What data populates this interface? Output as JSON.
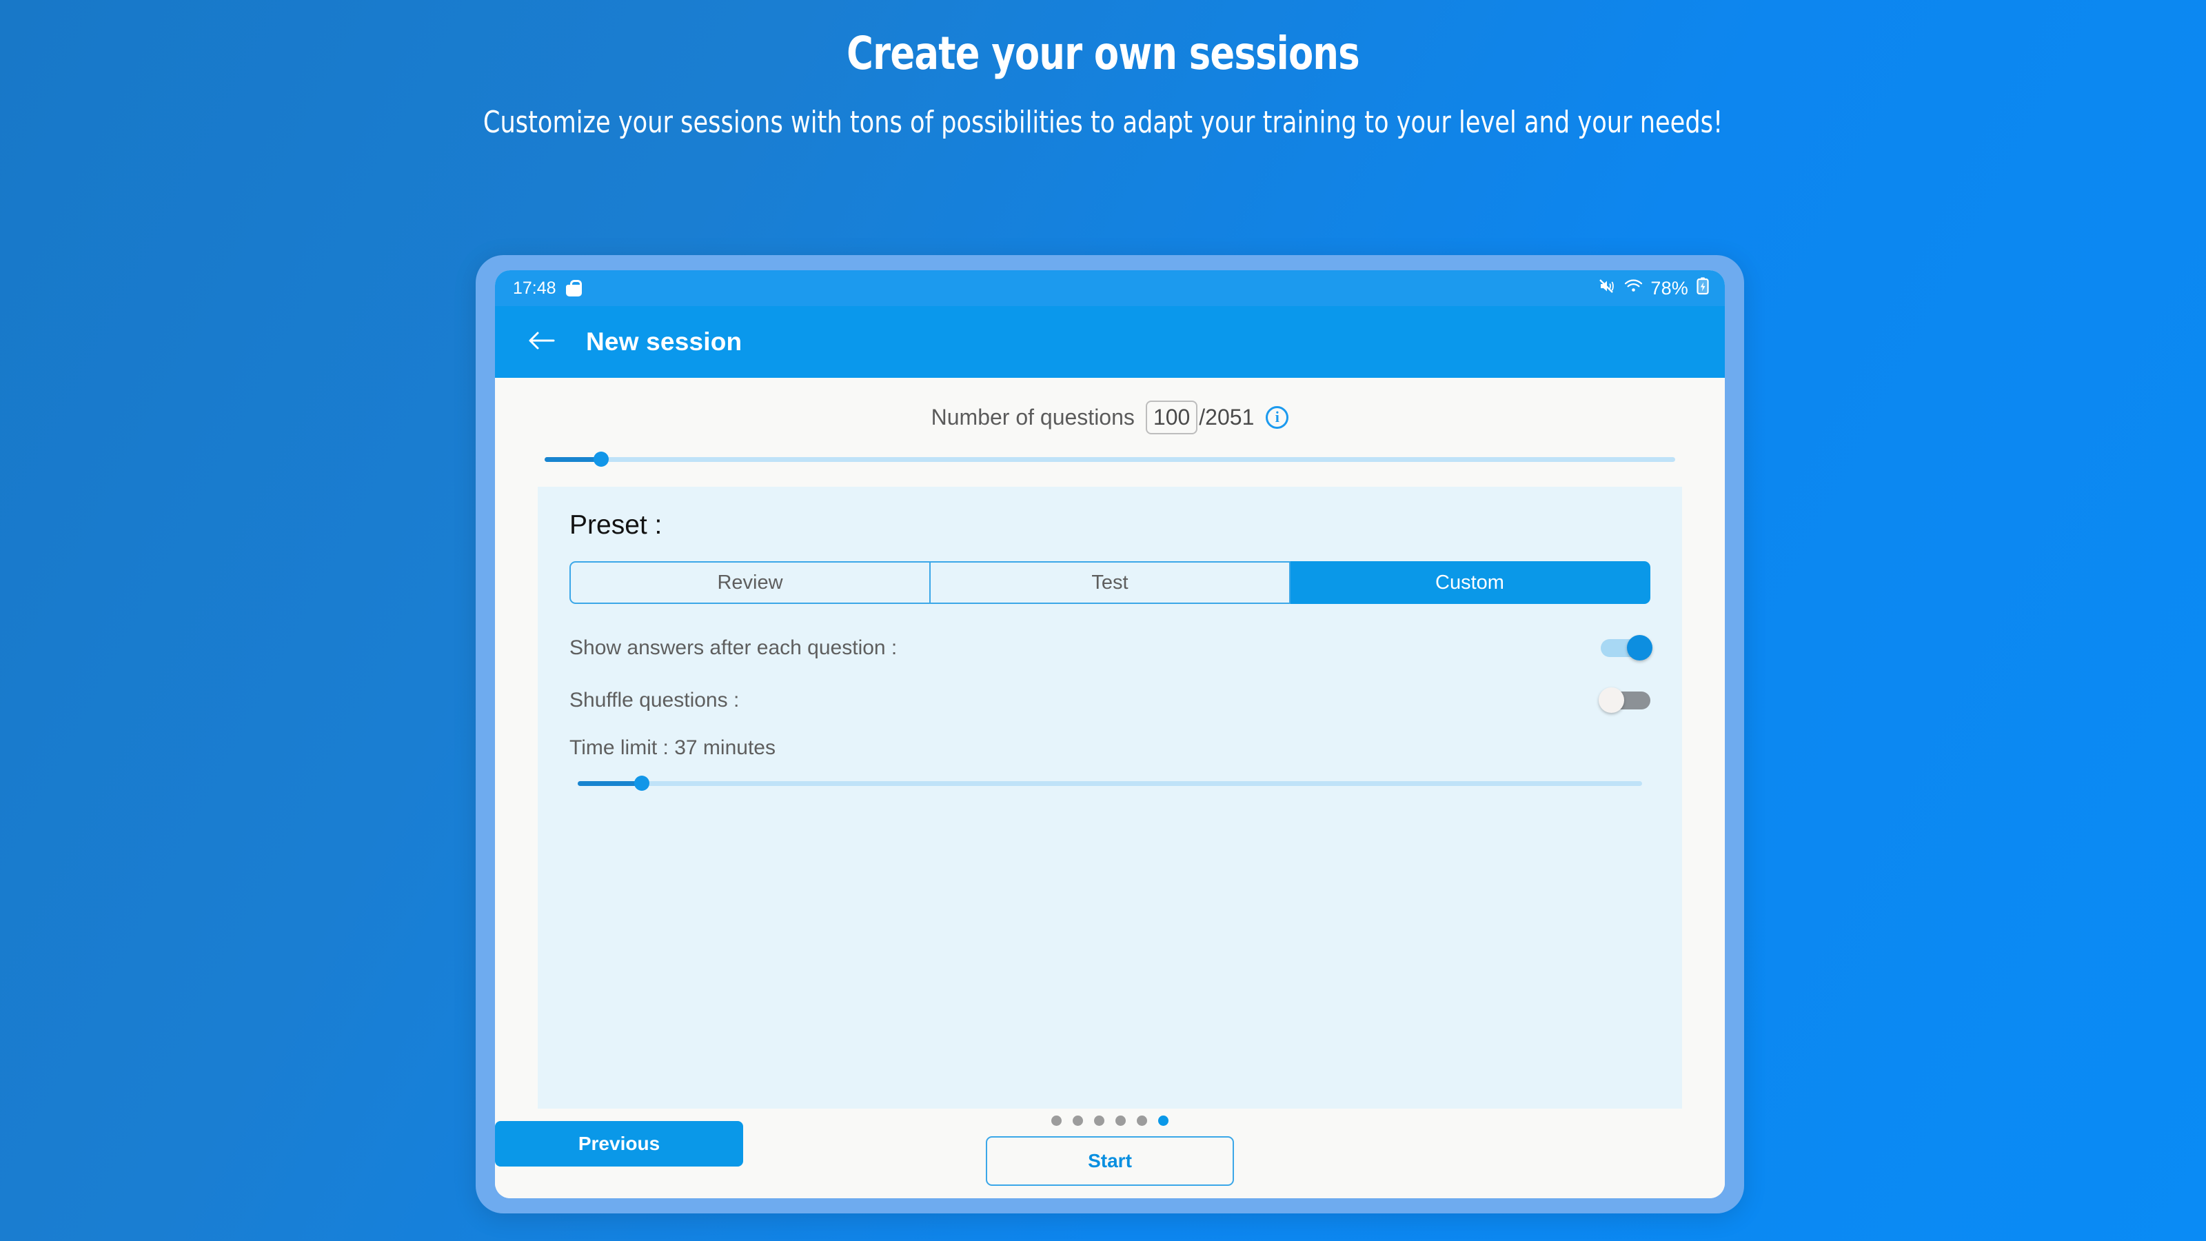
{
  "promo": {
    "title": "Create your own sessions",
    "subtitle": "Customize your sessions with tons of possibilities to adapt your training to your level and your needs!"
  },
  "device": {
    "statusbar": {
      "time": "17:48",
      "bag_icon": "shopping-bag-icon",
      "volume_icon": "volume-muted-icon",
      "wifi_icon": "wifi-icon",
      "battery_text": "78%",
      "battery_icon": "battery-charging-icon"
    },
    "appbar": {
      "back_icon": "back-arrow-icon",
      "title": "New session"
    }
  },
  "main": {
    "question_count": {
      "label": "Number of questions",
      "value": "100",
      "total": "/2051",
      "info_icon": "info-icon"
    },
    "count_slider": {
      "percent": 5,
      "value": 100,
      "min": 1,
      "max": 2051
    },
    "preset": {
      "label": "Preset :",
      "options": [
        {
          "label": "Review",
          "selected": false
        },
        {
          "label": "Test",
          "selected": false
        },
        {
          "label": "Custom",
          "selected": true
        }
      ]
    },
    "options": [
      {
        "label": "Show answers after each question :",
        "state": "on"
      },
      {
        "label": "Shuffle questions :",
        "state": "off"
      }
    ],
    "time_limit": {
      "label": "Time limit : 37 minutes",
      "minutes": 37,
      "percent": 6
    }
  },
  "bottom": {
    "previous_label": "Previous",
    "start_label": "Start",
    "dots_total": 6,
    "dots_active_index": 5
  },
  "colors": {
    "brand_blue": "#0a98e8",
    "appbar_blue": "#0a98ec",
    "statusbar_blue": "#1c9aee",
    "card_bg": "#e6f4fb",
    "screen_bg": "#f9f9f7",
    "bezel": "#6eabef",
    "toggle_on_track": "#a8d8f4",
    "toggle_off_track": "#8c9196"
  }
}
